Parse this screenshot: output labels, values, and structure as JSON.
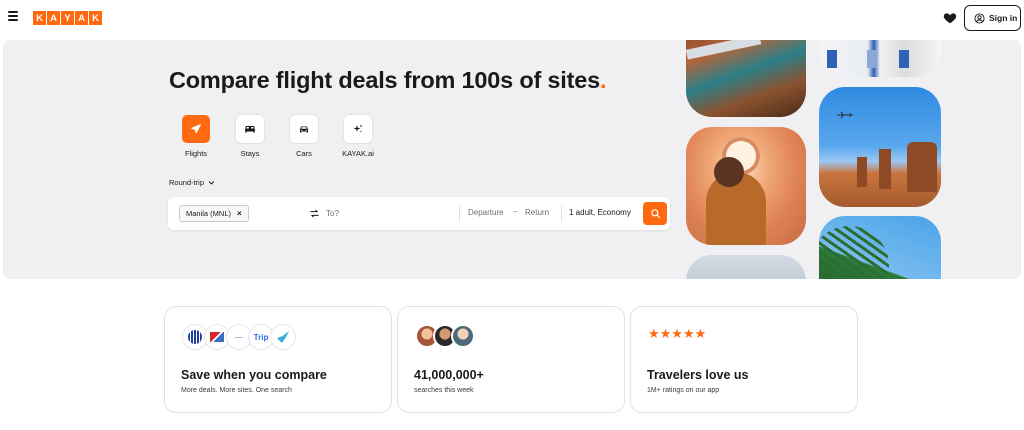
{
  "header": {
    "logo_letters": [
      "K",
      "A",
      "Y",
      "A",
      "K"
    ],
    "signin_label": "Sign in"
  },
  "hero": {
    "title": "Compare flight deals from 100s of sites",
    "title_dot": ".",
    "verticals": [
      {
        "label": "Flights",
        "icon": "plane-icon",
        "active": true
      },
      {
        "label": "Stays",
        "icon": "bed-icon",
        "active": false
      },
      {
        "label": "Cars",
        "icon": "car-icon",
        "active": false
      },
      {
        "label": "KAYAK.ai",
        "icon": "sparkle-icon",
        "active": false
      }
    ],
    "trip_type": "Round-trip"
  },
  "search": {
    "origin": "Manila (MNL)",
    "origin_remove": "×",
    "destination_value": "",
    "destination_placeholder": "To?",
    "departure": "Departure",
    "dash": "–",
    "return": "Return",
    "travelers": "1 adult, Economy"
  },
  "cards": [
    {
      "title": "Save when you compare",
      "sub": "More deals. More sites. One search",
      "logo_trip": "Trip"
    },
    {
      "title": "41,000,000+",
      "sub": "searches this week"
    },
    {
      "title": "Travelers love us",
      "sub": "1M+ ratings on our app",
      "stars": "★★★★★",
      "rating": 5
    }
  ],
  "colors": {
    "brand": "#ff690f",
    "hero_bg": "#f0f0f2",
    "text": "#1a1a1a"
  }
}
